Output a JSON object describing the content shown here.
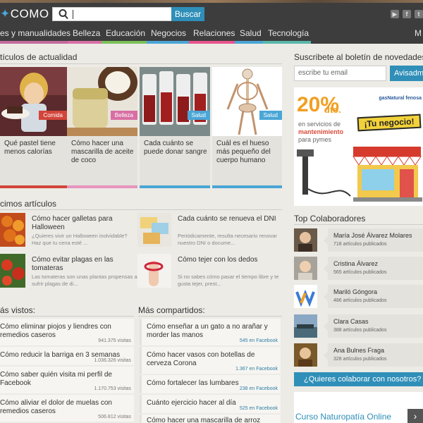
{
  "header": {
    "logo": "COMO",
    "search_button": "Buscar",
    "search_value": ""
  },
  "nav": [
    {
      "label": "es y manualidades",
      "color": "#c46b9e"
    },
    {
      "label": "Belleza",
      "color": "#d86fa4"
    },
    {
      "label": "Educación",
      "color": "#7cc05a"
    },
    {
      "label": "Negocios",
      "color": "#4aa6d6"
    },
    {
      "label": "Relaciones",
      "color": "#e8548c"
    },
    {
      "label": "Salud",
      "color": "#4aa6d6"
    },
    {
      "label": "Tecnología",
      "color": "#59b7a9"
    },
    {
      "label": "M",
      "color": "#3d3d3d"
    }
  ],
  "actualidad": {
    "title": "tículos de actualidad",
    "cards": [
      {
        "title": "Qué pastel tiene menos calorías",
        "tag": "Comida",
        "tag_color": "#d2453a",
        "bar_color": "#d2453a"
      },
      {
        "title": "Cómo hacer una mascarilla de aceite de coco",
        "tag": "Belleza",
        "tag_color": "#d86fa4",
        "bar_color": "#e894bd"
      },
      {
        "title": "Cada cuánto se puede donar sangre",
        "tag": "Salud",
        "tag_color": "#4aa6d6",
        "bar_color": "#4aa6d6"
      },
      {
        "title": "Cuál es el hueso más pequeño del cuerpo humano",
        "tag": "Salud",
        "tag_color": "#4aa6d6",
        "bar_color": "#4aa6d6"
      }
    ]
  },
  "ultimos": {
    "title": "cimos artículos",
    "items": [
      {
        "title": "Cómo hacer galletas para Halloween",
        "desc": "¿Quieres vivir un Halloween inolvidable? Haz que tu cena esté ..."
      },
      {
        "title": "Cada cuánto se renueva el DNI",
        "desc": "Periódicamente, resulta necesario renovar nuestro DNI o docume..."
      },
      {
        "title": "Cómo evitar plagas en las tomateras",
        "desc": "Las tomateras son unas plantas propensas a sufrir plagas de di..."
      },
      {
        "title": "Cómo tejer con los dedos",
        "desc": "Si no sabes cómo pasar el tiempo libre y te gusta tejer, prest..."
      }
    ]
  },
  "vistos": {
    "title": "ás vistos:",
    "items": [
      {
        "title": "Cómo eliminar piojos y liendres con remedios caseros",
        "count": "941.375 visitas"
      },
      {
        "title": "Cómo reducir la barriga en 3 semanas",
        "count": "1.036.326 visitas"
      },
      {
        "title": "Cómo saber quién visita mi perfil de Facebook",
        "count": "1.170.753 visitas"
      },
      {
        "title": "Cómo aliviar el dolor de muelas con remedios caseros",
        "count": "506.812 visitas"
      }
    ]
  },
  "compartidos": {
    "title": "Más compartidos:",
    "items": [
      {
        "title": "Cómo enseñar a un gato a no arañar y morder las manos",
        "count": "545 en Facebook"
      },
      {
        "title": "Cómo hacer vasos con botellas de cerveza Corona",
        "count": "1.367 en Facebook"
      },
      {
        "title": "Cómo fortalecer las lumbares",
        "count": "238 en Facebook"
      },
      {
        "title": "Cuánto ejercicio hacer al día",
        "count": "525 en Facebook"
      },
      {
        "title": "Cómo hacer una mascarilla de arroz",
        "count": ""
      }
    ]
  },
  "sidebar": {
    "newsletter_title": "Suscribete al boletín de novedades",
    "newsletter_placeholder": "escribe tu email",
    "newsletter_button": "Avisadme",
    "ad": {
      "pct": "20%",
      "dto": "dto.",
      "brand": "gasNatural fenosa",
      "line1": "en servicios de",
      "line2": "mantenimiento",
      "line3": "para pymes",
      "sign": "¡Tu negocio!"
    },
    "colab_title": "Top Colaboradores",
    "colaboradores": [
      {
        "name": "María José Álvarez Molares",
        "count": "718 artículos publicados"
      },
      {
        "name": "Cristina Álvarez",
        "count": "565 artículos publicados"
      },
      {
        "name": "Mariló Góngora",
        "count": "486 artículos publicados"
      },
      {
        "name": "Clara Casas",
        "count": "388 artículos publicados"
      },
      {
        "name": "Ana Bulnes Fraga",
        "count": "328 artículos publicados"
      }
    ],
    "collab_button": "¿Quieres colaborar con nosotros?",
    "bottom_ad": "Curso Naturopatía Online",
    "bottom_ad_arrow": "›"
  }
}
